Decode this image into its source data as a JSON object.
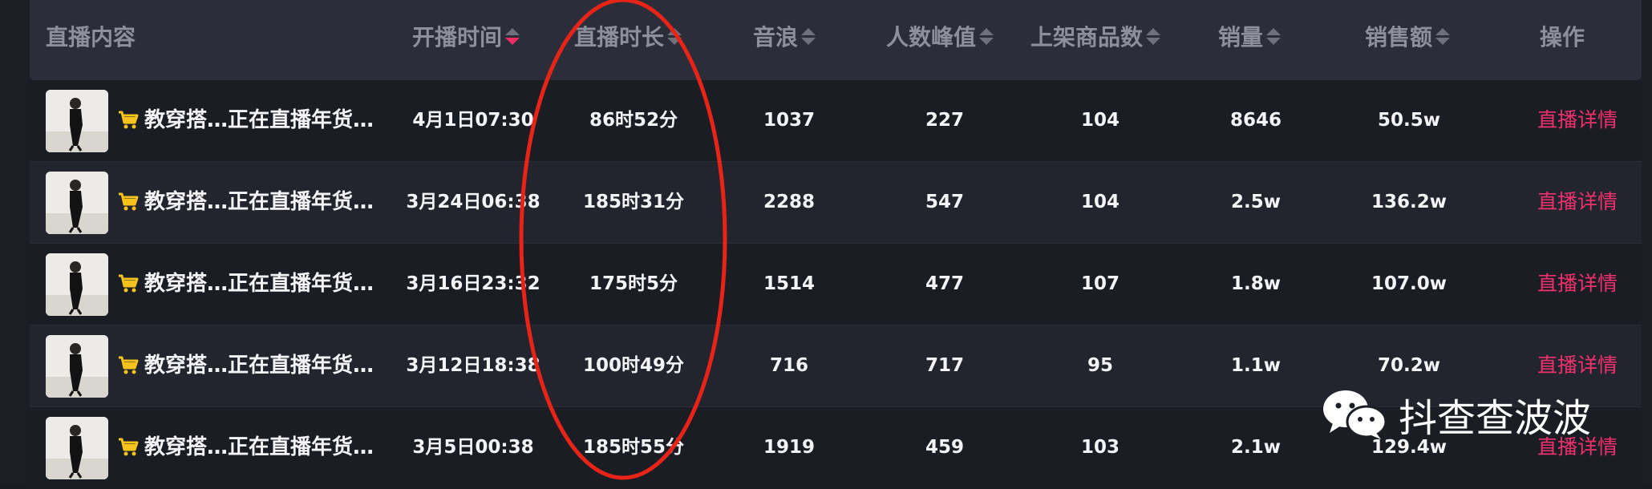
{
  "colors": {
    "background": "#1c1e26",
    "header_bg": "#2b2e38",
    "header_text": "#8d909a",
    "row_text": "#f4f4f6",
    "action": "#f0306c",
    "sort_active": "#ef2b66",
    "cart": "#f6c21c",
    "annotation": "#e82418"
  },
  "table": {
    "headers": {
      "content": "直播内容",
      "start_time": "开播时间",
      "duration": "直播时长",
      "sound_wave": "音浪",
      "peak_viewers": "人数峰值",
      "products": "上架商品数",
      "sales": "销量",
      "revenue": "销售额",
      "action": "操作"
    },
    "sort_icon": "sort-icon",
    "rows": [
      {
        "title": "教穿搭…正在直播年货…",
        "start_time": "4月1日07:30",
        "duration": "86时52分",
        "sound_wave": "1037",
        "peak_viewers": "227",
        "products": "104",
        "sales": "8646",
        "revenue": "50.5w",
        "action": "直播详情"
      },
      {
        "title": "教穿搭…正在直播年货…",
        "start_time": "3月24日06:38",
        "duration": "185时31分",
        "sound_wave": "2288",
        "peak_viewers": "547",
        "products": "104",
        "sales": "2.5w",
        "revenue": "136.2w",
        "action": "直播详情"
      },
      {
        "title": "教穿搭…正在直播年货…",
        "start_time": "3月16日23:32",
        "duration": "175时5分",
        "sound_wave": "1514",
        "peak_viewers": "477",
        "products": "107",
        "sales": "1.8w",
        "revenue": "107.0w",
        "action": "直播详情"
      },
      {
        "title": "教穿搭…正在直播年货…",
        "start_time": "3月12日18:38",
        "duration": "100时49分",
        "sound_wave": "716",
        "peak_viewers": "717",
        "products": "95",
        "sales": "1.1w",
        "revenue": "70.2w",
        "action": "直播详情"
      },
      {
        "title": "教穿搭…正在直播年货…",
        "start_time": "3月5日00:38",
        "duration": "185时55分",
        "sound_wave": "1919",
        "peak_viewers": "459",
        "products": "103",
        "sales": "2.1w",
        "revenue": "129.4w",
        "action": "直播详情"
      }
    ]
  },
  "watermark": {
    "icon": "wechat-icon",
    "text": "抖查查波波"
  }
}
